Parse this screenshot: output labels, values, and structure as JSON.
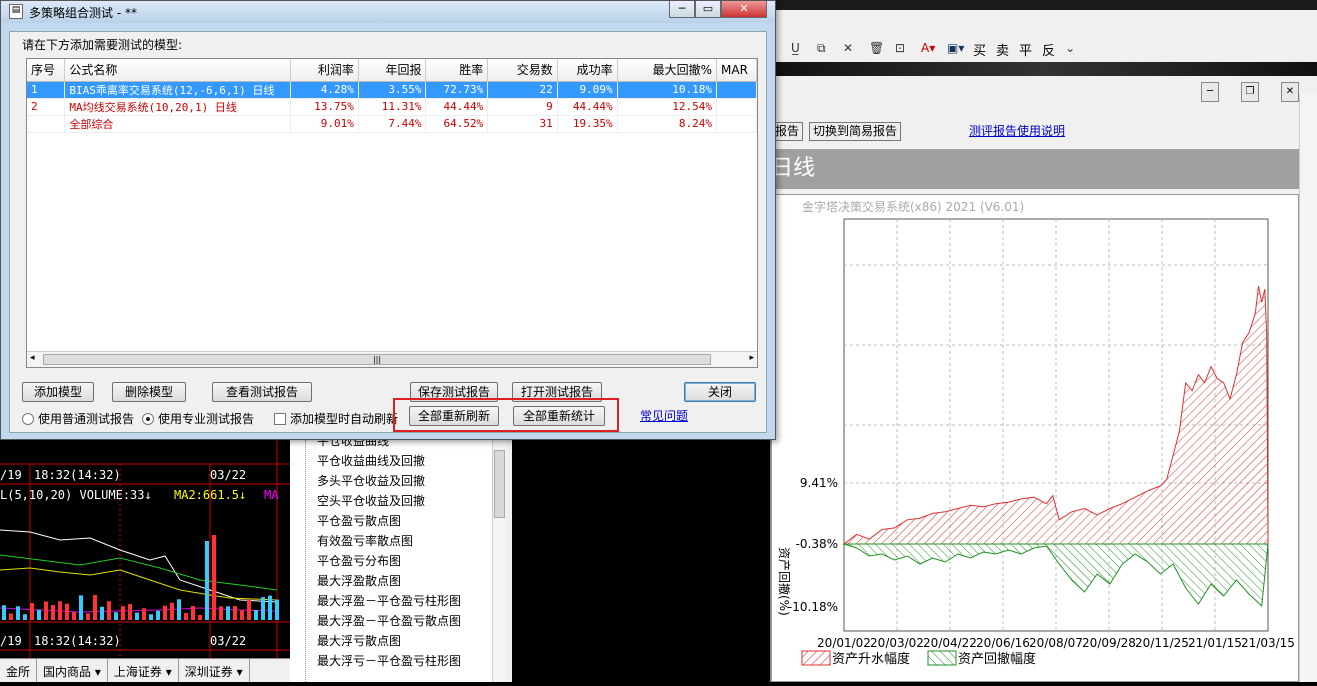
{
  "dialog": {
    "title": "多策略组合测试 - **",
    "prompt": "请在下方添加需要测试的模型:",
    "columns": [
      "序号",
      "公式名称",
      "利润率",
      "年回报",
      "胜率",
      "交易数",
      "成功率",
      "最大回撤%",
      "MAR"
    ],
    "rows": [
      {
        "no": "1",
        "name": "BIAS乖离率交易系统(12,-6,6,1) 日线",
        "profit": "4.28%",
        "annual": "3.55%",
        "win": "72.73%",
        "trades": "22",
        "success": "9.09%",
        "drawdown": "10.18%"
      },
      {
        "no": "2",
        "name": "MA均线交易系统(10,20,1) 日线",
        "profit": "13.75%",
        "annual": "11.31%",
        "win": "44.44%",
        "trades": "9",
        "success": "44.44%",
        "drawdown": "12.54%"
      },
      {
        "no": "",
        "name": "全部综合",
        "profit": "9.01%",
        "annual": "7.44%",
        "win": "64.52%",
        "trades": "31",
        "success": "19.35%",
        "drawdown": "8.24%"
      }
    ],
    "buttons": {
      "add": "添加模型",
      "delete": "删除模型",
      "view": "查看测试报告",
      "save": "保存测试报告",
      "open": "打开测试报告",
      "close": "关闭",
      "refresh_all": "全部重新刷新",
      "stat_all": "全部重新统计"
    },
    "options": {
      "normal": "使用普通测试报告",
      "pro": "使用专业测试报告",
      "auto_refresh": "添加模型时自动刷新"
    },
    "faq": "常见问题"
  },
  "back": {
    "toolbar": [
      "买",
      "卖",
      "平",
      "反"
    ],
    "report_btn_partial": "报告",
    "switch_btn": "切换到简易报告",
    "help_link": "测评报告使用说明",
    "banner": "日线",
    "sidebar_items": [
      "平仓收益曲线",
      "平仓收益曲线及回撤",
      "多头平仓收益及回撤",
      "空头平仓收益及回撤",
      "平仓盈亏散点图",
      "有效盈亏率散点图",
      "平仓盈亏分布图",
      "最大浮盈散点图",
      "最大浮盈－平仓盈亏柱形图",
      "最大浮盈－平仓盈亏散点图",
      "最大浮亏散点图",
      "最大浮亏－平仓盈亏柱形图"
    ]
  },
  "stock": {
    "date1": "/19",
    "time1": "18:32(14:32)",
    "date2": "03/22",
    "indicator": "L(5,10,20) VOLUME:33↓",
    "ma2": "MA2:661.5↓",
    "ma3": "MA",
    "date3": "/19",
    "time3": "18:32(14:32)",
    "date4": "03/22",
    "tabs": [
      "金所",
      "国内商品",
      "上海证券",
      "深圳证券"
    ]
  },
  "chart_data": {
    "type": "area",
    "title": "金字塔决策交易系统(x86) 2021 (V6.01)",
    "ylabel": "资产回撤(%)",
    "y_ticks": [
      "9.41%",
      "-0.38%",
      "-10.18%"
    ],
    "x_ticks": [
      "20/01/02",
      "20/03/02",
      "20/04/22",
      "20/06/16",
      "20/08/07",
      "20/09/28",
      "20/11/25",
      "21/01/15",
      "21/03/15"
    ],
    "series": [
      {
        "name": "资产升水幅度",
        "color": "#e03030"
      },
      {
        "name": "资产回撤幅度",
        "color": "#209020"
      }
    ],
    "legend": "bottom"
  }
}
